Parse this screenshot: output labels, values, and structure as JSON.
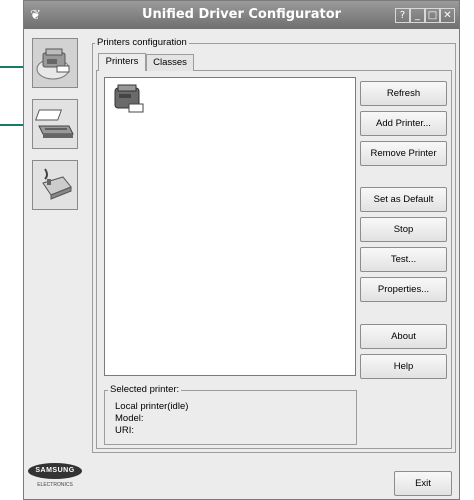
{
  "window": {
    "title": "Unified Driver Configurator",
    "controls": [
      "?",
      "_",
      "□",
      "✕"
    ]
  },
  "sidebar": {
    "items": [
      {
        "name": "printer-config",
        "icon": "printer-icon",
        "active": true
      },
      {
        "name": "scanner-config",
        "icon": "scanner-icon",
        "active": false
      },
      {
        "name": "ports-config",
        "icon": "port-plug-icon",
        "active": false
      }
    ]
  },
  "printers_group": {
    "legend": "Printers configuration",
    "tabs": [
      "Printers",
      "Classes"
    ],
    "active_tab": "Printers"
  },
  "printer_list": {
    "items": [
      {
        "icon": "printer-icon"
      }
    ]
  },
  "buttons": {
    "refresh": "Refresh",
    "add_printer": "Add Printer...",
    "remove_printer": "Remove Printer",
    "set_default": "Set as Default",
    "stop": "Stop",
    "test": "Test...",
    "properties": "Properties...",
    "about": "About",
    "help": "Help",
    "exit": "Exit"
  },
  "selected_printer": {
    "legend": "Selected printer:",
    "status": "Local printer(idle)",
    "model": "Model:",
    "uri": "URI:"
  },
  "brand": {
    "logo": "SAMSUNG",
    "sub": "ELECTRONICS"
  },
  "colors": {
    "titlebar": "#7f7f7f",
    "callout": "#1a7a6a",
    "window_bg": "#ececec"
  }
}
